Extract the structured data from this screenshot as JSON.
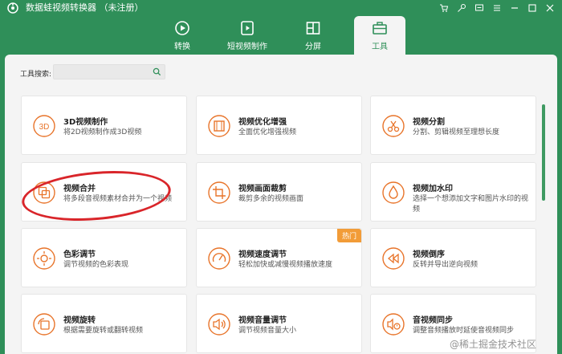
{
  "window": {
    "title": "数据蛙视频转换器 （未注册）"
  },
  "tabs": [
    {
      "label": "转换",
      "icon": "convert-icon"
    },
    {
      "label": "短视频制作",
      "icon": "short-video-icon"
    },
    {
      "label": "分屏",
      "icon": "split-screen-icon"
    },
    {
      "label": "工具",
      "icon": "toolbox-icon",
      "active": true
    }
  ],
  "search": {
    "label": "工具搜索:",
    "value": ""
  },
  "tools": [
    {
      "title": "3D视频制作",
      "desc": "将2D视频制作成3D视频",
      "icon": "3d-icon"
    },
    {
      "title": "视频优化增强",
      "desc": "全面优化增强视频",
      "icon": "video-enhance-icon"
    },
    {
      "title": "视频分割",
      "desc": "分割、剪辑视频至理想长度",
      "icon": "scissors-icon"
    },
    {
      "title": "视频合并",
      "desc": "将多段音视频素材合并为一个视频",
      "icon": "merge-icon"
    },
    {
      "title": "视频画面裁剪",
      "desc": "裁剪多余的视频画面",
      "icon": "crop-icon"
    },
    {
      "title": "视频加水印",
      "desc": "选择一个想添加文字和图片水印的视频",
      "icon": "watermark-drop-icon"
    },
    {
      "title": "色彩调节",
      "desc": "调节视频的色彩表现",
      "icon": "color-adjust-icon"
    },
    {
      "title": "视频速度调节",
      "desc": "轻松加快或减慢视频播放速度",
      "icon": "speed-gauge-icon",
      "badge": "热门"
    },
    {
      "title": "视频倒序",
      "desc": "反转并导出逆向视频",
      "icon": "rewind-icon"
    },
    {
      "title": "视频旋转",
      "desc": "根据需要旋转或翻转视频",
      "icon": "rotate-icon"
    },
    {
      "title": "视频音量调节",
      "desc": "调节视频音量大小",
      "icon": "volume-icon"
    },
    {
      "title": "音视频同步",
      "desc": "调整音频播放时延使音视频同步",
      "icon": "av-sync-icon"
    }
  ],
  "watermark_text": "@稀土掘金技术社区",
  "colors": {
    "brand_green": "#2f8f59",
    "accent_orange": "#e8742a",
    "hot_badge": "#f29c38",
    "annotation_red": "#d9252a"
  }
}
